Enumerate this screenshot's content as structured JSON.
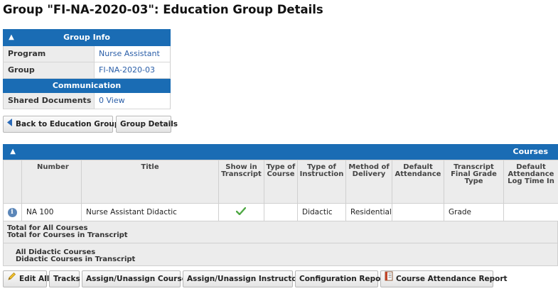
{
  "page": {
    "title": "Group \"FI-NA-2020-03\": Education Group Details"
  },
  "group_info": {
    "header": "Group Info",
    "rows": [
      {
        "label": "Program",
        "value": "Nurse Assistant"
      },
      {
        "label": "Group",
        "value": "FI-NA-2020-03"
      }
    ],
    "communication_header": "Communication",
    "shared_documents_label": "Shared Documents",
    "shared_documents_value": "0 View"
  },
  "nav_buttons": {
    "back": "Back to Education Groups",
    "group_details": "Group Details"
  },
  "courses": {
    "header": "Courses",
    "columns": [
      "",
      "Number",
      "Title",
      "Show in Transcript",
      "Type of Course",
      "Type of Instruction",
      "Method of Delivery",
      "Default Attendance",
      "Transcript Final Grade Type",
      "Default Attendance Log Time In"
    ],
    "rows": [
      {
        "number": "NA 100",
        "title": "Nurse Assistant Didactic",
        "show_in_transcript": true,
        "type_of_course": "",
        "type_of_instruction": "Didactic",
        "method_of_delivery": "Residential",
        "default_attendance": "",
        "final_grade_type": "Grade",
        "log_time_in": ""
      }
    ],
    "totals": {
      "all_courses": "Total for All Courses",
      "transcript_courses": "Total for Courses in Transcript",
      "all_didactic": "All Didactic Courses",
      "didactic_transcript": "Didactic Courses in Transcript"
    }
  },
  "toolbar": {
    "edit_all": "Edit All",
    "tracks": "Tracks",
    "assign_courses": "Assign/Unassign Courses",
    "assign_instructors": "Assign/Unassign Instructors",
    "configuration_report": "Configuration Report",
    "attendance_report": "Course Attendance Report"
  },
  "colors": {
    "header_blue": "#1a6cb4",
    "link_blue": "#2a5ea8",
    "check_green": "#4ea843"
  }
}
